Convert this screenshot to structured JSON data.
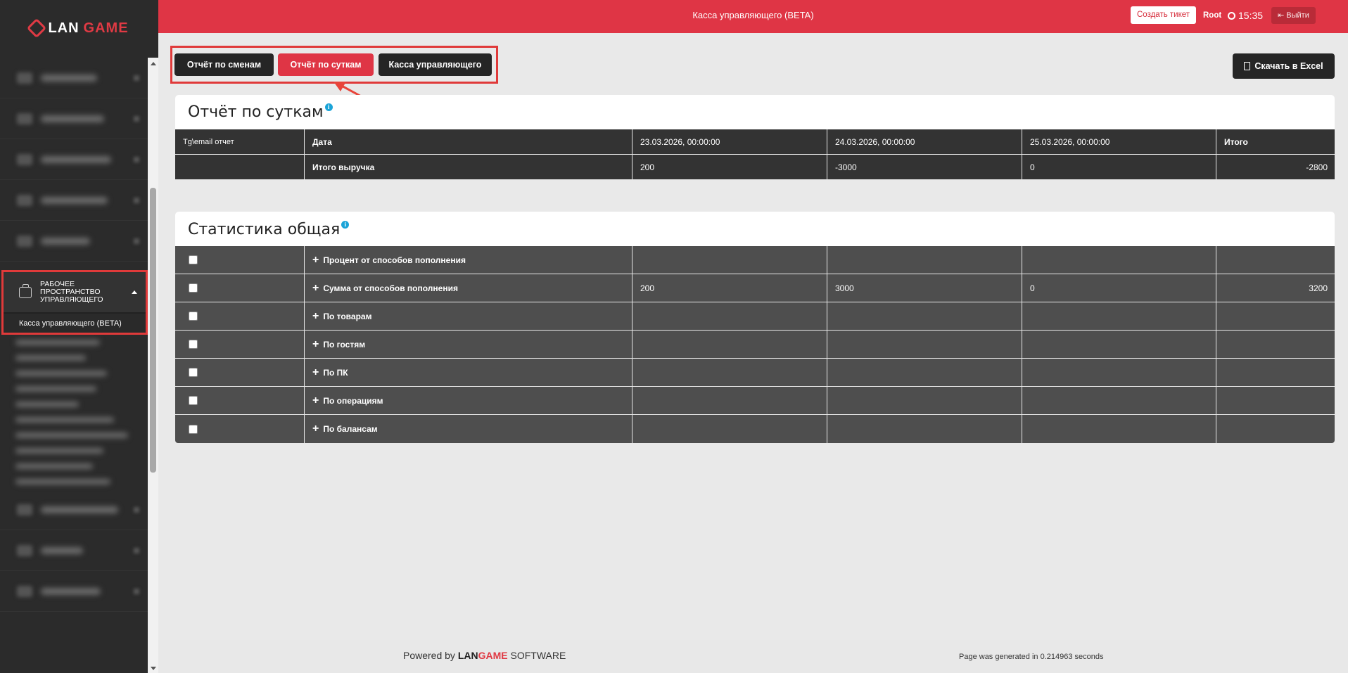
{
  "app": {
    "logo_lan": "LAN",
    "logo_game": "GAME"
  },
  "sidebar": {
    "workspace_title": "РАБОЧЕЕ ПРОСТРАНСТВО УПРАВЛЯЮЩЕГО",
    "workspace_subitem": "Касса управляющего (BETA)"
  },
  "topbar": {
    "title": "Касса управляющего (BETA)",
    "ticket_label": "Создать тикет",
    "user": "Root",
    "time": "15:35",
    "logout_label": "Выйти"
  },
  "tabs": [
    {
      "label": "Отчёт по сменам",
      "active": false
    },
    {
      "label": "Отчёт по суткам",
      "active": true
    },
    {
      "label": "Касса управляющего",
      "active": false
    }
  ],
  "excel_label": "Скачать в Excel",
  "daily_report": {
    "title": "Отчёт по суткам",
    "header": [
      "Tg\\email отчет",
      "Дата",
      "23.03.2026, 00:00:00",
      "24.03.2026, 00:00:00",
      "25.03.2026, 00:00:00",
      "Итого"
    ],
    "rows": [
      [
        "",
        "Итого выручка",
        "200",
        "-3000",
        "0",
        "-2800"
      ]
    ]
  },
  "stats": {
    "title": "Статистика общая",
    "rows": [
      {
        "label": "Процент от способов пополнения",
        "values": [
          "",
          "",
          "",
          ""
        ]
      },
      {
        "label": "Сумма от способов пополнения",
        "values": [
          "200",
          "3000",
          "0",
          "3200"
        ]
      },
      {
        "label": "По товарам",
        "values": [
          "",
          "",
          "",
          ""
        ]
      },
      {
        "label": "По гостям",
        "values": [
          "",
          "",
          "",
          ""
        ]
      },
      {
        "label": "По ПК",
        "values": [
          "",
          "",
          "",
          ""
        ]
      },
      {
        "label": "По операциям",
        "values": [
          "",
          "",
          "",
          ""
        ]
      },
      {
        "label": "По балансам",
        "values": [
          "",
          "",
          "",
          ""
        ]
      }
    ]
  },
  "footer": {
    "powered_by": "Powered by",
    "brand_lan": "LAN",
    "brand_game": "GAME",
    "brand_software": "SOFTWARE",
    "generated": "Page was generated in 0.214963 seconds"
  },
  "colors": {
    "accent": "#df3545",
    "dark": "#252525",
    "info": "#1ba4d8"
  }
}
